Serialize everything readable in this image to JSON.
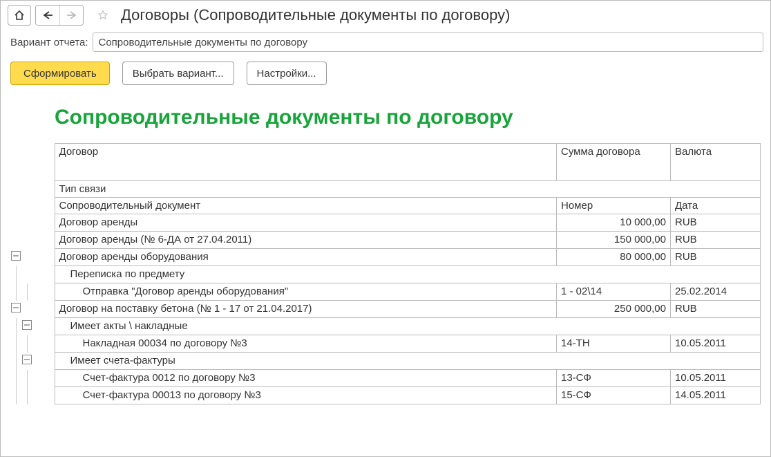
{
  "topbar": {
    "title": "Договоры (Сопроводительные документы по договору)"
  },
  "variant": {
    "label": "Вариант отчета:",
    "value": "Сопроводительные документы по договору"
  },
  "actions": {
    "generate": "Сформировать",
    "choose_variant": "Выбрать вариант...",
    "settings": "Настройки..."
  },
  "report": {
    "title": "Сопроводительные документы по договору",
    "headers": {
      "contract": "Договор",
      "sum": "Сумма договора",
      "currency": "Валюта",
      "link_type": "Тип связи",
      "doc": "Сопроводительный документ",
      "number": "Номер",
      "date": "Дата"
    },
    "rows": [
      {
        "level": 0,
        "c1": "Договор аренды",
        "c2": "10 000,00",
        "c3": "RUB",
        "toggle": null
      },
      {
        "level": 0,
        "c1": "Договор аренды (№ 6-ДА от 27.04.2011)",
        "c2": "150 000,00",
        "c3": "RUB",
        "toggle": null
      },
      {
        "level": 0,
        "c1": "Договор аренды оборудования",
        "c2": "80 000,00",
        "c3": "RUB",
        "toggle": "minus"
      },
      {
        "level": 1,
        "c1": "Переписка по предмету",
        "c2": "",
        "c3": "",
        "toggle": null
      },
      {
        "level": 2,
        "c1": "Отправка \"Договор аренды оборудования\"",
        "c2": "1 - 02\\14",
        "c3": "25.02.2014",
        "toggle": null
      },
      {
        "level": 0,
        "c1": "Договор на поставку бетона (№ 1 - 17 от 21.04.2017)",
        "c2": "250 000,00",
        "c3": "RUB",
        "toggle": "minus"
      },
      {
        "level": 1,
        "c1": "Имеет акты \\ накладные",
        "c2": "",
        "c3": "",
        "toggle": "minus2"
      },
      {
        "level": 2,
        "c1": "Накладная 00034 по договору №3",
        "c2": "14-ТН",
        "c3": "10.05.2011",
        "toggle": null
      },
      {
        "level": 1,
        "c1": "Имеет счета-фактуры",
        "c2": "",
        "c3": "",
        "toggle": "minus2"
      },
      {
        "level": 2,
        "c1": "Счет-фактура 0012 по договору №3",
        "c2": "13-СФ",
        "c3": "10.05.2011",
        "toggle": null
      },
      {
        "level": 2,
        "c1": "Счет-фактура 00013 по договору №3",
        "c2": "15-СФ",
        "c3": "14.05.2011",
        "toggle": null
      }
    ]
  }
}
